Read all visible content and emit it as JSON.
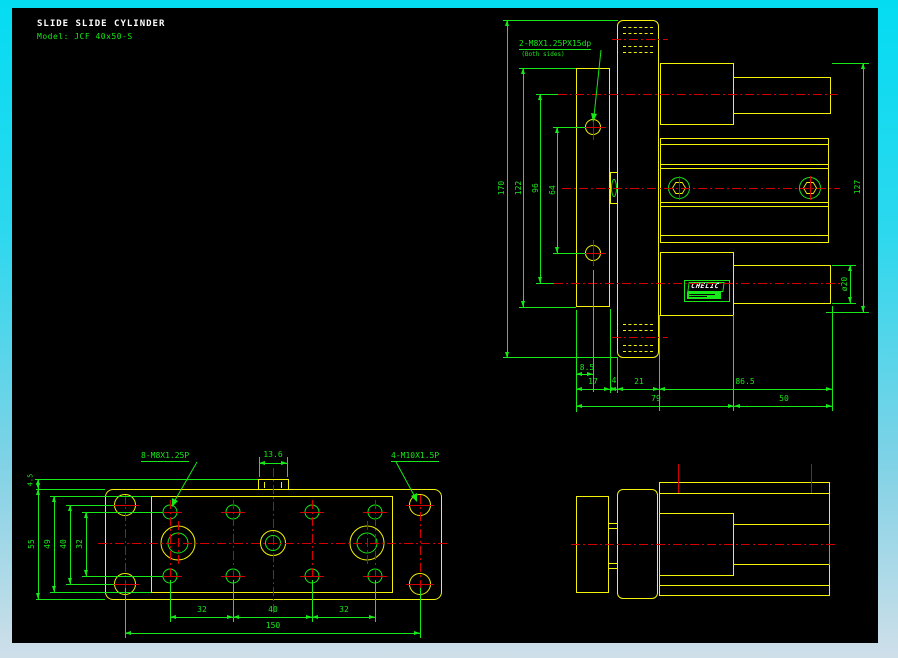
{
  "title": "SLIDE SLIDE CYLINDER",
  "model": "Model: JCF 40x50-S",
  "colors": {
    "geometry_yellow": "#f2f20a",
    "dimension_green": "#17e817",
    "centerline_red": "#d40000",
    "canvas_black": "#000000",
    "chrome_cyan": "#04dcf2"
  },
  "side_view": {
    "thread_label": "2-M8X1.25PX15dp",
    "thread_note": "(Both sides)",
    "nameplate_brand": "CHELIC",
    "dims": {
      "overall_height": "170",
      "flange_height": "122",
      "rod_centers": "96",
      "bolt_centers": "64",
      "hole_offset": "8.5",
      "flange_thk": "17",
      "gap": "4",
      "table_thk": "21",
      "body_len": "86.5",
      "front_len": "79",
      "stroke": "50",
      "rod_dia": "ø20",
      "body_height": "127"
    }
  },
  "plan_view": {
    "label_m8": "8-M8X1.25P",
    "label_m10": "4-M10X1.5P",
    "dims": {
      "slot_w": "13.6",
      "notch_h": "4.5",
      "plate_h": "55",
      "inner_h": "49",
      "corner_rows": "40",
      "hole_rows": "32",
      "pitch_a": "32",
      "pitch_b": "40",
      "pitch_c": "32",
      "overall_w": "150"
    }
  }
}
